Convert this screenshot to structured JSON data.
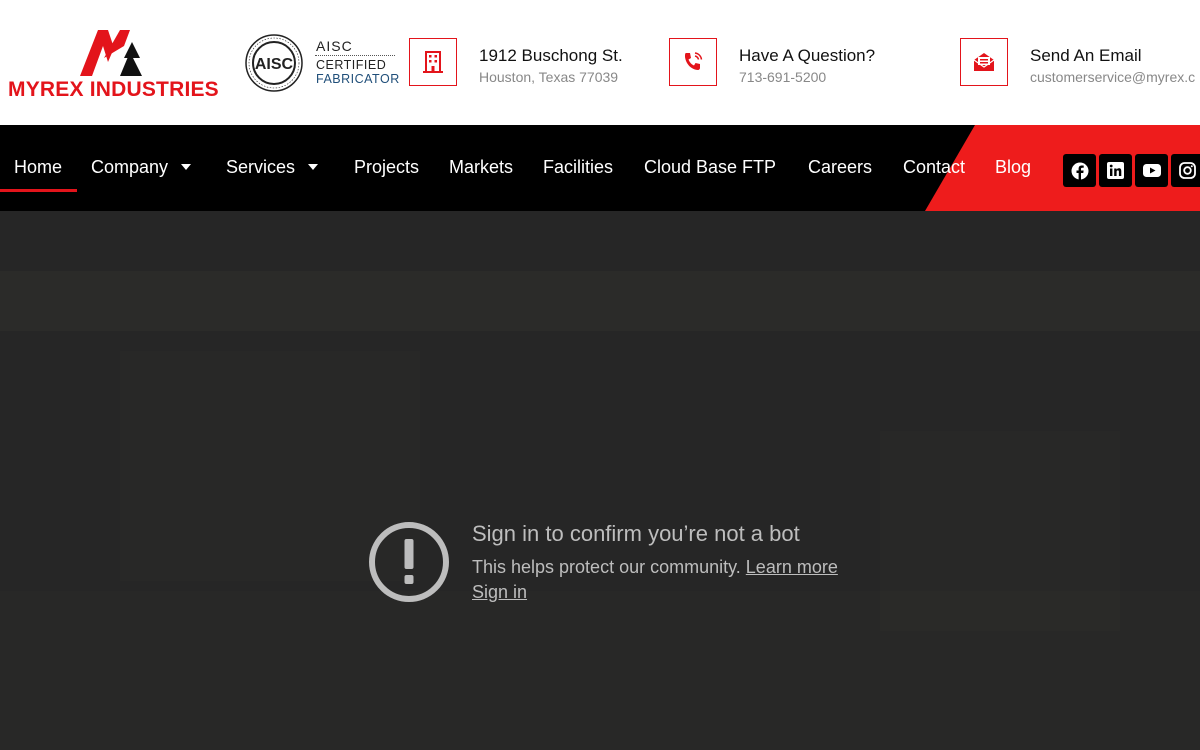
{
  "header": {
    "brand_name": "MYREX INDUSTRIES",
    "certification": {
      "badge_line1": "AISC",
      "badge_line2": "CERTIFIED",
      "badge_line3": "FABRICATOR",
      "seal_text": "AISC"
    },
    "address": {
      "title": "1912 Buschong St.",
      "subtitle": "Houston, Texas 77039",
      "icon": "building-icon"
    },
    "phone": {
      "title": "Have A Question?",
      "subtitle": "713-691-5200",
      "icon": "phone-icon"
    },
    "email": {
      "title": "Send An Email",
      "subtitle": "customerservice@myrex.c",
      "icon": "envelope-icon"
    }
  },
  "nav": {
    "items": [
      {
        "label": "Home",
        "active": true
      },
      {
        "label": "Company",
        "dropdown": true
      },
      {
        "label": "Services",
        "dropdown": true
      },
      {
        "label": "Projects"
      },
      {
        "label": "Markets"
      },
      {
        "label": "Facilities"
      },
      {
        "label": "Cloud Base FTP"
      },
      {
        "label": "Careers"
      },
      {
        "label": "Contact"
      },
      {
        "label": "Blog"
      }
    ],
    "social": [
      "facebook-icon",
      "linkedin-icon",
      "youtube-icon",
      "instagram-icon"
    ]
  },
  "notice": {
    "title": "Sign in to confirm you’re not a bot",
    "description": "This helps protect our community.",
    "learn_more": "Learn more",
    "sign_in": "Sign in"
  },
  "colors": {
    "brand_red": "#e3141b",
    "nav_background": "#000000",
    "nav_accent_red": "#ee1c1c",
    "overlay_background": "#262626",
    "overlay_text": "#bdbdbd"
  }
}
